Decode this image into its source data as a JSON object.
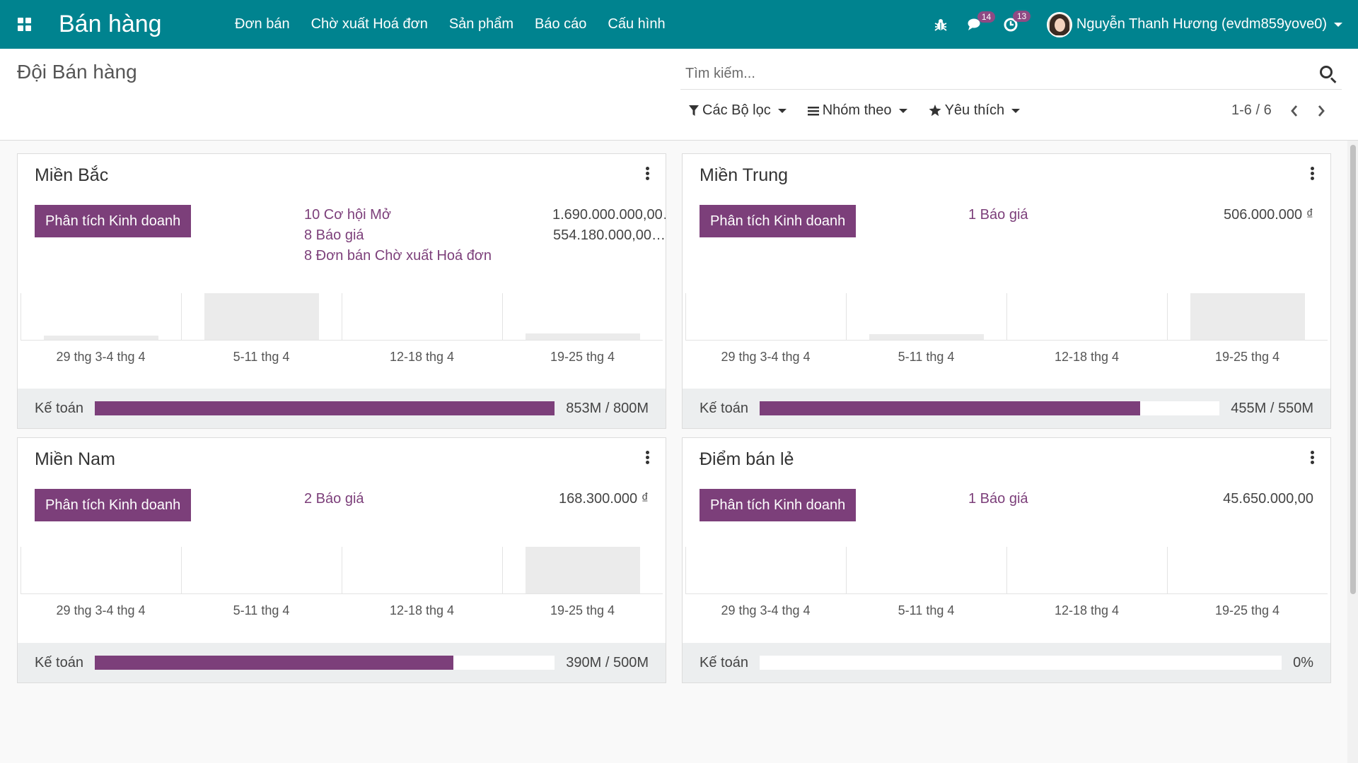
{
  "nav": {
    "brand": "Bán hàng",
    "menu": [
      "Đơn bán",
      "Chờ xuất Hoá đơn",
      "Sản phẩm",
      "Báo cáo",
      "Cấu hình"
    ],
    "messages_count": "14",
    "activities_count": "13",
    "user_name": "Nguyễn Thanh Hương (evdm859yove0)"
  },
  "control": {
    "title": "Đội Bán hàng",
    "search_placeholder": "Tìm kiếm...",
    "filters_label": "Các Bộ lọc",
    "groupby_label": "Nhóm theo",
    "favorites_label": "Yêu thích",
    "pager": "1-6 / 6"
  },
  "colors": {
    "navbar": "#00838f",
    "primary": "#7c3f7a",
    "bar": "#ebebeb"
  },
  "cards": [
    {
      "title": "Miền Bắc",
      "button": "Phân tích Kinh doanh",
      "links": [
        "10 Cơ hội Mở",
        "8 Báo giá",
        "8 Đơn bán Chờ xuất Hoá đơn"
      ],
      "amounts": [
        "1.690.000.000,00…",
        "554.180.000,00…"
      ],
      "weeks": [
        "29 thg 3-4 thg 4",
        "5-11 thg 4",
        "12-18 thg 4",
        "19-25 thg 4"
      ],
      "week_values": [
        0.06,
        1.0,
        0,
        0.14
      ],
      "invoice_label": "Kế toán",
      "progress": 1.0,
      "progress_text": "853M / 800M"
    },
    {
      "title": "Miền Trung",
      "button": "Phân tích Kinh doanh",
      "links": [
        "1 Báo giá"
      ],
      "amounts": [
        "506.000.000 ₫"
      ],
      "weeks": [
        "29 thg 3-4 thg 4",
        "5-11 thg 4",
        "12-18 thg 4",
        "19-25 thg 4"
      ],
      "week_values": [
        0,
        0.12,
        0,
        1.0
      ],
      "invoice_label": "Kế toán",
      "progress": 0.827,
      "progress_text": "455M / 550M"
    },
    {
      "title": "Miền Nam",
      "button": "Phân tích Kinh doanh",
      "links": [
        "2 Báo giá"
      ],
      "amounts": [
        "168.300.000 ₫"
      ],
      "weeks": [
        "29 thg 3-4 thg 4",
        "5-11 thg 4",
        "12-18 thg 4",
        "19-25 thg 4"
      ],
      "week_values": [
        0,
        0,
        0,
        1.0
      ],
      "invoice_label": "Kế toán",
      "progress": 0.78,
      "progress_text": "390M / 500M"
    },
    {
      "title": "Điểm bán lẻ",
      "button": "Phân tích Kinh doanh",
      "links": [
        "1 Báo giá"
      ],
      "amounts": [
        "45.650.000,00"
      ],
      "weeks": [
        "29 thg 3-4 thg 4",
        "5-11 thg 4",
        "12-18 thg 4",
        "19-25 thg 4"
      ],
      "week_values": [
        0,
        0,
        0,
        0
      ],
      "invoice_label": "Kế toán",
      "progress": 0,
      "progress_text": "0%"
    }
  ]
}
